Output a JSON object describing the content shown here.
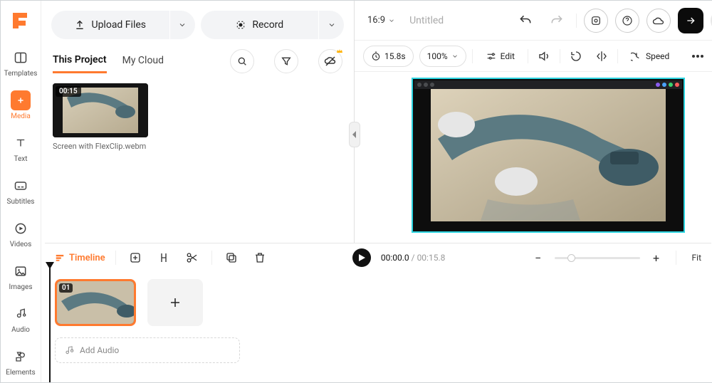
{
  "brand": {
    "logo_letter": "F",
    "accent": "#ff7a2f"
  },
  "sidebar": {
    "items": [
      {
        "label": "Templates"
      },
      {
        "label": "Media"
      },
      {
        "label": "Text"
      },
      {
        "label": "Subtitles"
      },
      {
        "label": "Videos"
      },
      {
        "label": "Images"
      },
      {
        "label": "Audio"
      },
      {
        "label": "Elements"
      }
    ],
    "active_index": 1
  },
  "upload": {
    "upload_label": "Upload Files",
    "record_label": "Record"
  },
  "media_tabs": {
    "tabs": [
      "This Project",
      "My Cloud"
    ],
    "active_index": 0
  },
  "media": {
    "items": [
      {
        "duration_badge": "00:15",
        "filename": "Screen with FlexClip.webm"
      }
    ]
  },
  "project": {
    "aspect_ratio": "16:9",
    "title": "Untitled"
  },
  "preview_toolbar": {
    "duration_label": "15.8s",
    "zoom_label": "100%",
    "edit_label": "Edit",
    "speed_label": "Speed"
  },
  "playback": {
    "current": "00:00.0",
    "total": "00:15.8",
    "fit_label": "Fit"
  },
  "timeline": {
    "mode_label": "Timeline",
    "clips": [
      {
        "badge": "01"
      }
    ],
    "add_audio_label": "Add Audio"
  }
}
